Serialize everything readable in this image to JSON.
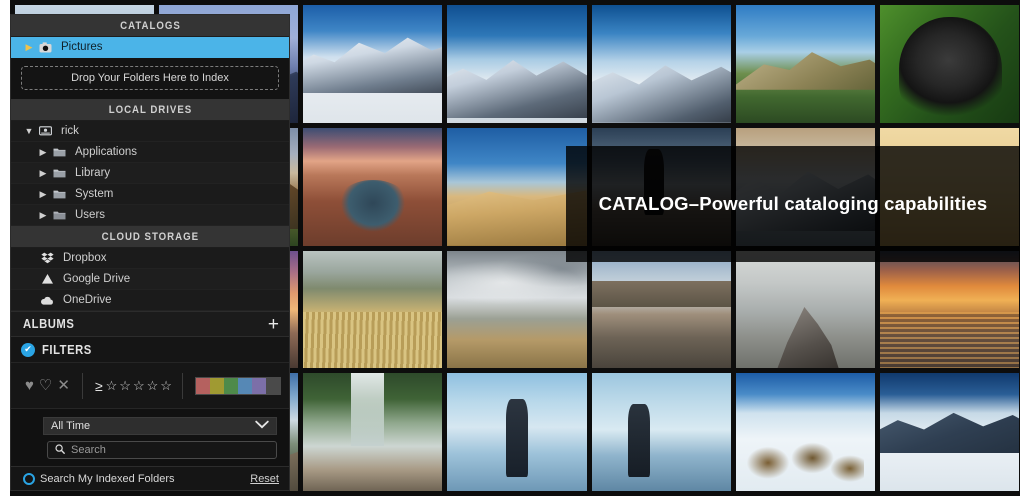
{
  "app": {
    "caption_overlay": "CATALOG–Powerful cataloging capabilities"
  },
  "sidebar": {
    "catalogs": {
      "header": "CATALOGS",
      "items": [
        {
          "label": "Pictures",
          "icon": "camera-icon",
          "expander": "▶",
          "selected": true
        }
      ],
      "drop_zone_label": "Drop Your Folders Here to Index"
    },
    "local_drives": {
      "header": "LOCAL DRIVES",
      "root": {
        "label": "rick",
        "icon": "drive-icon",
        "expander": "▼"
      },
      "items": [
        {
          "label": "Applications",
          "icon": "folder-icon",
          "expander": "▶"
        },
        {
          "label": "Library",
          "icon": "folder-icon",
          "expander": "▶"
        },
        {
          "label": "System",
          "icon": "folder-icon",
          "expander": "▶"
        },
        {
          "label": "Users",
          "icon": "folder-icon",
          "expander": "▶"
        }
      ]
    },
    "cloud_storage": {
      "header": "CLOUD STORAGE",
      "items": [
        {
          "label": "Dropbox",
          "icon": "dropbox-icon"
        },
        {
          "label": "Google Drive",
          "icon": "google-drive-icon"
        },
        {
          "label": "OneDrive",
          "icon": "onedrive-icon"
        }
      ]
    },
    "albums": {
      "title": "ALBUMS",
      "add_label": "+"
    },
    "filters": {
      "title": "FILTERS",
      "enabled_check": "✔",
      "flags": [
        {
          "name": "flag-pick-icon",
          "glyph": "♥"
        },
        {
          "name": "flag-unpick-icon",
          "glyph": "♡"
        },
        {
          "name": "flag-reject-icon",
          "glyph": "✕"
        }
      ],
      "rating": {
        "operator": "≥",
        "stars": [
          "☆",
          "☆",
          "☆",
          "☆",
          "☆"
        ],
        "selected_count": 0
      },
      "color_labels": [
        "#b5615f",
        "#a09a32",
        "#4e8a4a",
        "#5688b5",
        "#7c6fa8",
        "#4a4a4a"
      ],
      "date_select": {
        "value": "All Time",
        "chevron": "⌄",
        "options": [
          "All Time"
        ]
      },
      "search": {
        "placeholder": "Search",
        "value": "",
        "icon": "search-icon"
      },
      "indexed_toggle": {
        "label": "Search My Indexed Folders",
        "checked": false
      },
      "reset_label": "Reset"
    }
  },
  "photo_grid": {
    "columns": 7,
    "rows": 4,
    "cells": [
      {
        "name": "photo-alpenglow-peak",
        "cls": "p-alpenglow"
      },
      {
        "name": "photo-denali-climber",
        "cls": "p-denali"
      },
      {
        "name": "photo-mountain-climbers",
        "cls": "p-climbers"
      },
      {
        "name": "photo-skiers-ridge",
        "cls": "p-skier2"
      },
      {
        "name": "photo-green-hillside",
        "cls": "p-greenhill"
      },
      {
        "name": "photo-gorilla",
        "cls": "p-gorilla"
      },
      {
        "name": "photo-zion-canyon",
        "cls": "p-zion"
      },
      {
        "name": "photo-horseshoe-bend",
        "cls": "p-horseshoe"
      },
      {
        "name": "photo-sand-dune-photographer",
        "cls": "p-dune"
      },
      {
        "name": "photo-photographer-silhouette",
        "cls": "p-photog"
      },
      {
        "name": "photo-snow-ridge",
        "cls": "p-snowridge"
      },
      {
        "name": "photo-sand-texture",
        "cls": "p-sand"
      },
      {
        "name": "photo-sunset-silhouette-road",
        "cls": "p-sunsetgirl"
      },
      {
        "name": "photo-birds-over-grass",
        "cls": "p-birds"
      },
      {
        "name": "photo-moody-clouds",
        "cls": "p-moody"
      },
      {
        "name": "photo-salt-flat",
        "cls": "p-saltflat"
      },
      {
        "name": "photo-man-on-peak",
        "cls": "p-peakman"
      },
      {
        "name": "photo-sea-sunset",
        "cls": "p-seasunset"
      },
      {
        "name": "photo-driftwood-mountains",
        "cls": "p-driftwood"
      },
      {
        "name": "photo-waterfall-rocks",
        "cls": "p-waterfall"
      },
      {
        "name": "photo-surf-photographer",
        "cls": "p-surfshoot"
      },
      {
        "name": "photo-coast-photographer",
        "cls": "p-coastshoot"
      },
      {
        "name": "photo-bears-in-snow",
        "cls": "p-bears"
      },
      {
        "name": "photo-downhill-skier",
        "cls": "p-skier3"
      }
    ]
  }
}
